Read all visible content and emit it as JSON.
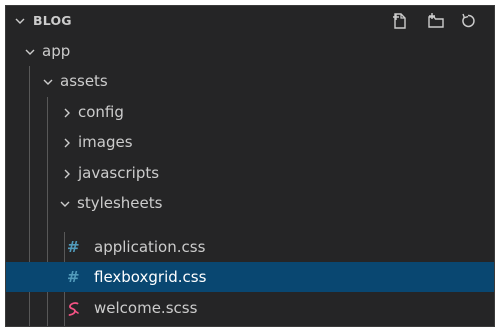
{
  "explorer": {
    "title": "BLOG",
    "actions": {
      "new_file_icon": "new-file-icon",
      "new_folder_icon": "new-folder-icon",
      "refresh_icon": "refresh-icon"
    }
  },
  "tree": {
    "app": {
      "label": "app",
      "expanded": true
    },
    "assets": {
      "label": "assets",
      "expanded": true
    },
    "config": {
      "label": "config",
      "expanded": false
    },
    "images": {
      "label": "images",
      "expanded": false
    },
    "javascripts": {
      "label": "javascripts",
      "expanded": false
    },
    "stylesheets": {
      "label": "stylesheets",
      "expanded": true
    },
    "application_css": {
      "label": "application.css",
      "icon": "css-hash-icon"
    },
    "flexboxgrid_css": {
      "label": "flexboxgrid.css",
      "icon": "css-hash-icon",
      "selected": true
    },
    "welcome_scss": {
      "label": "welcome.scss",
      "icon": "sass-icon"
    }
  },
  "colors": {
    "background": "#252526",
    "selection": "#094771",
    "css_icon": "#519aba",
    "sass_icon": "#f55385",
    "text": "#cccccc"
  }
}
